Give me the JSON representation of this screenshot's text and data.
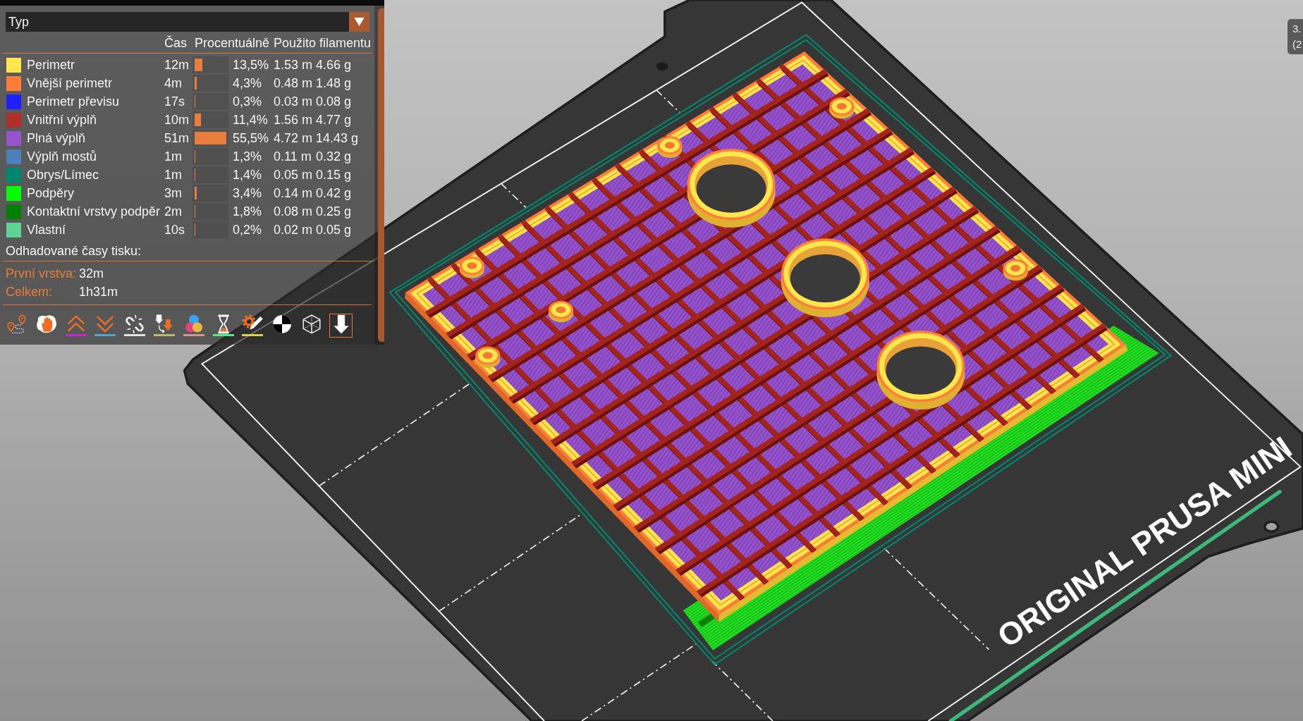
{
  "legend": {
    "view_type": "Typ",
    "columns": [
      "Čas",
      "Procentuálně",
      "Použito filamentu"
    ],
    "rows": [
      {
        "name": "Perimetr",
        "color": "#ffe64d",
        "time": "12m",
        "level": 0.243,
        "percent": "13,5%",
        "length": "1.53 m",
        "weight": "4.66 g"
      },
      {
        "name": "Vnější perimetr",
        "color": "#ff7d38",
        "time": "4m",
        "level": 0.077,
        "percent": "4,3%",
        "length": "0.48 m",
        "weight": "1.48 g"
      },
      {
        "name": "Perimetr převisu",
        "color": "#1f1fff",
        "time": "17s",
        "level": 0.005,
        "percent": "0,3%",
        "length": "0.03 m",
        "weight": "0.08 g"
      },
      {
        "name": "Vnitřní výplň",
        "color": "#b03029",
        "time": "10m",
        "level": 0.205,
        "percent": "11,4%",
        "length": "1.56 m",
        "weight": "4.77 g"
      },
      {
        "name": "Plná výplň",
        "color": "#9654cc",
        "time": "51m",
        "level": 1,
        "percent": "55,5%",
        "length": "4.72 m",
        "weight": "14.43 g"
      },
      {
        "name": "Výplň mostů",
        "color": "#4d80ba",
        "time": "1m",
        "level": 0.023,
        "percent": "1,3%",
        "length": "0.11 m",
        "weight": "0.32 g"
      },
      {
        "name": "Obrys/Límec",
        "color": "#00876e",
        "time": "1m",
        "level": 0.025,
        "percent": "1,4%",
        "length": "0.05 m",
        "weight": "0.15 g"
      },
      {
        "name": "Podpěry",
        "color": "#00ff00",
        "time": "3m",
        "level": 0.061,
        "percent": "3,4%",
        "length": "0.14 m",
        "weight": "0.42 g"
      },
      {
        "name": "Kontaktní vrstvy podpěr",
        "color": "#008000",
        "time": "2m",
        "level": 0.032,
        "percent": "1,8%",
        "length": "0.08 m",
        "weight": "0.25 g"
      },
      {
        "name": "Vlastní",
        "color": "#5ed194",
        "time": "10s",
        "level": 0.004,
        "percent": "0,2%",
        "length": "0.02 m",
        "weight": "0.05 g"
      }
    ],
    "estimates": {
      "title": "Odhadované časy tisku:",
      "items": [
        {
          "label": "První vrstva:",
          "value": "32m"
        },
        {
          "label": "Celkem:",
          "value": "1h31m"
        }
      ]
    },
    "toolbar": [
      {
        "kind": "travel",
        "selected": false
      },
      {
        "kind": "wipe",
        "selected": false
      },
      {
        "kind": "retractions",
        "color": "#cd22d6",
        "selected": false
      },
      {
        "kind": "deretractions",
        "color": "#49adcf",
        "selected": false
      },
      {
        "kind": "seams",
        "color": "#e6e6e6",
        "selected": false
      },
      {
        "kind": "tool_changes",
        "color": "#c1be63",
        "selected": false
      },
      {
        "kind": "color_changes",
        "color": "#da948b",
        "selected": false
      },
      {
        "kind": "pause_prints",
        "color": "#52f083",
        "selected": false
      },
      {
        "kind": "custom_gcode",
        "color": "#e2d243",
        "selected": false
      },
      {
        "kind": "center_of_gravity",
        "selected": false
      },
      {
        "kind": "shells",
        "selected": false
      },
      {
        "kind": "tool_marker",
        "selected": true
      }
    ]
  },
  "viewport": {
    "bed_label": "ORIGINAL PRUSA MINI"
  },
  "tooltip": {
    "lines": [
      "3.",
      "(2"
    ]
  }
}
